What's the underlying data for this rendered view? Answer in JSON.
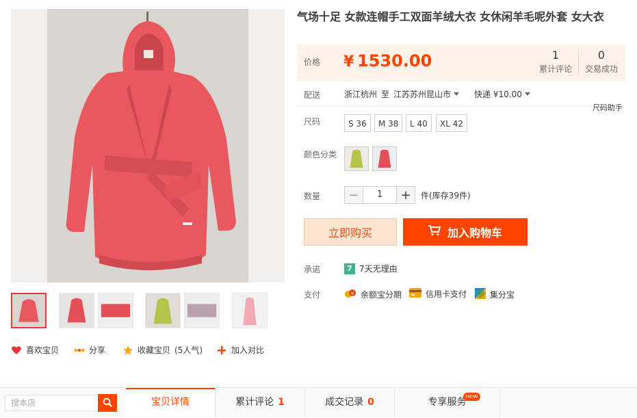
{
  "product": {
    "title": "气场十足 女款连帽手工双面羊绒大衣 女休闲羊毛呢外套  女大衣",
    "accent_color": "#ff4400",
    "garment_color": "#e8595f"
  },
  "price": {
    "label": "价格",
    "symbol": "¥",
    "value": "1530.00",
    "reviews_count": "1",
    "reviews_label": "累计评论",
    "sales_count": "0",
    "sales_label": "交易成功"
  },
  "delivery": {
    "label": "配送",
    "from": "浙江杭州",
    "to_word": "至",
    "destination": "江苏苏州昆山市",
    "shipping": "快递 ¥10.00"
  },
  "size": {
    "label": "尺码",
    "helper": "尺码助手",
    "options": [
      "S 36",
      "M 38",
      "L 40",
      "XL 42"
    ]
  },
  "color": {
    "label": "颜色分类",
    "swatches": [
      "yellow-green coat",
      "coral red coat"
    ]
  },
  "quantity": {
    "label": "数量",
    "value": "1",
    "minus": "−",
    "plus": "+",
    "stock": "件(库存39件)"
  },
  "buttons": {
    "buy_now": "立即购买",
    "add_to_cart": "加入购物车"
  },
  "promise": {
    "label": "承诺",
    "badge": "7",
    "text": "7天无理由"
  },
  "payment": {
    "label": "支付",
    "methods": [
      "余额宝分期",
      "信用卡支付",
      "集分宝"
    ]
  },
  "actions": {
    "like": "喜欢宝贝",
    "share": "分享",
    "favorite": "收藏宝贝",
    "favorite_count": "(5人气)",
    "compare": "加入对比"
  },
  "bottom": {
    "search_placeholder": "搜本店",
    "tabs": [
      {
        "label": "宝贝详情"
      },
      {
        "label": "累计评论",
        "count": "1"
      },
      {
        "label": "成交记录",
        "count": "0"
      },
      {
        "label": "专享服务",
        "badge": "new"
      }
    ]
  }
}
